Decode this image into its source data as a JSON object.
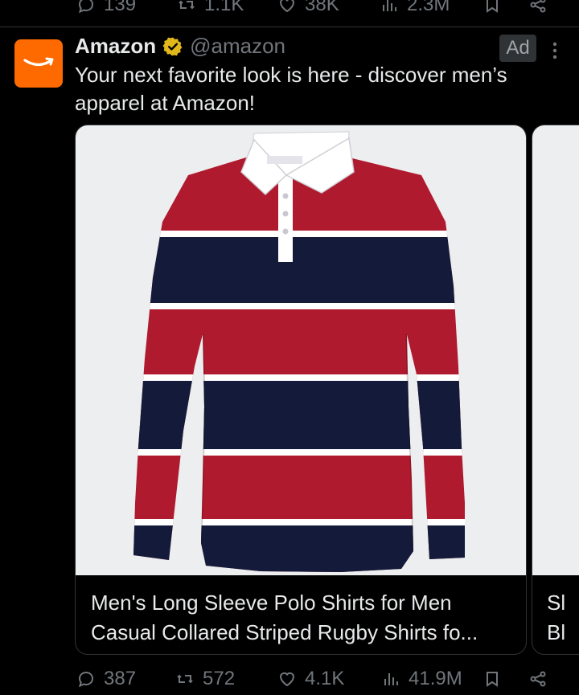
{
  "prev_post_actions": {
    "replies": "139",
    "reposts": "1.1K",
    "likes": "38K",
    "views": "2.3M"
  },
  "post": {
    "author_name": "Amazon",
    "author_handle": "@amazon",
    "ad_label": "Ad",
    "text": "Your next favorite look is here - discover men’s apparel at Amazon!",
    "avatar_color": "#ff6a00",
    "verified_color": "#e2b719"
  },
  "cards": [
    {
      "title": "Men's Long Sleeve Polo Shirts for Men Casual Collared Striped Rugby Shirts fo...",
      "product_colors": [
        "#b01a2e",
        "#141b3a",
        "#ffffff"
      ]
    },
    {
      "title": "Sl Bl"
    }
  ],
  "actions": {
    "replies": "387",
    "reposts": "572",
    "likes": "4.1K",
    "views": "41.9M"
  },
  "icons": [
    "reply-icon",
    "repost-icon",
    "like-icon",
    "views-icon",
    "bookmark-icon",
    "share-icon",
    "verified-badge-icon",
    "more-icon",
    "amazon-logo"
  ]
}
